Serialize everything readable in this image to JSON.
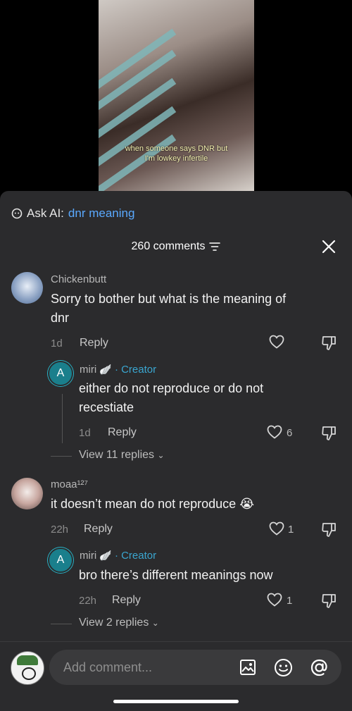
{
  "video": {
    "caption_line1": "when someone says DNR but",
    "caption_line2": "I'm lowkey infertile"
  },
  "ask_ai": {
    "prefix": "Ask AI:",
    "query": "dnr meaning"
  },
  "comments_header": {
    "count_label": "260 comments"
  },
  "comments": [
    {
      "username": "Chickenbutt",
      "text_line1": "Sorry to bother but what is the meaning of",
      "text_line2": "dnr",
      "time": "1d",
      "reply_label": "Reply",
      "likes": ""
    },
    {
      "username": "miri",
      "creator_label": "· Creator",
      "text_line1": "either do not reproduce or do not",
      "text_line2": "recestiate",
      "time": "1d",
      "reply_label": "Reply",
      "likes": "6",
      "view_replies": "View 11 replies"
    },
    {
      "username": "moaa¹²⁷",
      "text_line1": "it doesn’t mean do not reproduce 😭",
      "time": "22h",
      "reply_label": "Reply",
      "likes": "1"
    },
    {
      "username": "miri",
      "creator_label": "· Creator",
      "text_line1": "bro there’s different meanings now",
      "time": "22h",
      "reply_label": "Reply",
      "likes": "1",
      "view_replies": "View 2 replies"
    }
  ],
  "composer": {
    "placeholder": "Add comment..."
  },
  "avatar_letter": "A",
  "colors": {
    "sheet_bg": "#2b2b2d",
    "creator_blue": "#3aa6d0",
    "link_blue": "#5aa9ff",
    "input_bg": "#3a3a3c"
  }
}
